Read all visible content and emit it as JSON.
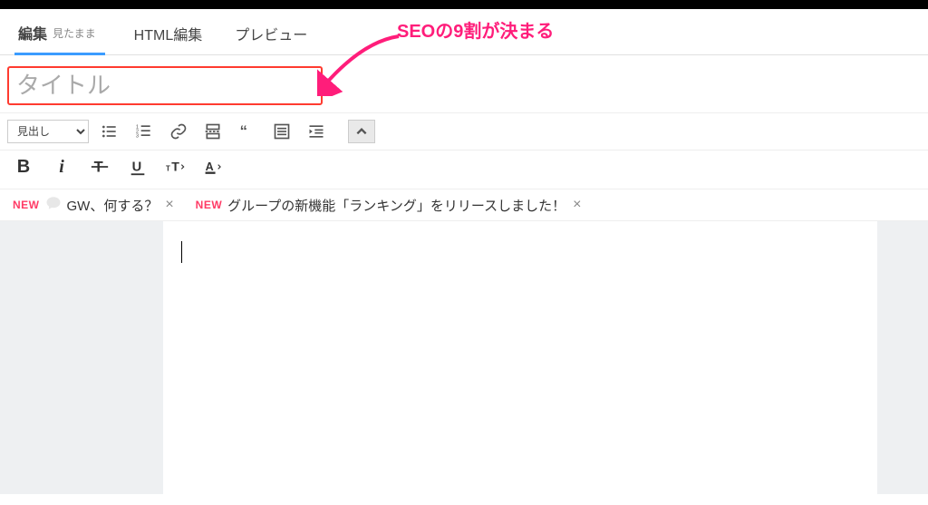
{
  "tabs": {
    "edit": {
      "label": "編集",
      "sublabel": "見たまま"
    },
    "html": {
      "label": "HTML編集"
    },
    "preview": {
      "label": "プレビュー"
    }
  },
  "annotation": {
    "text": "SEOの9割が決まる"
  },
  "title": {
    "placeholder": "タイトル",
    "value": ""
  },
  "toolbar": {
    "heading_select": "見出し"
  },
  "notices": {
    "new_badge": "NEW",
    "item1": {
      "text": "GW、何する？"
    },
    "item2": {
      "text": "グループの新機能「ランキング」をリリースしました！"
    }
  },
  "editor": {
    "content": ""
  }
}
